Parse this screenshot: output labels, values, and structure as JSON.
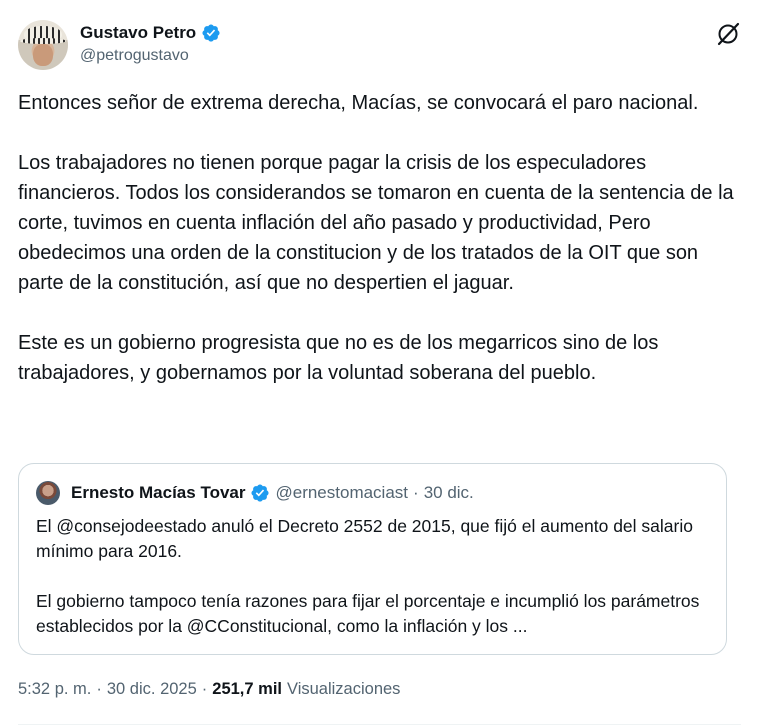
{
  "author": {
    "display_name": "Gustavo Petro",
    "handle": "@petrogustavo",
    "verified_icon": "verified-badge-icon",
    "avatar_icon": "avatar"
  },
  "actions": {
    "grok_icon": "grok-icon"
  },
  "tweet": {
    "paragraphs": [
      "Entonces señor de extrema derecha, Macías, se convocará el paro nacional.",
      "Los trabajadores no tienen porque pagar la crisis de los especuladores financieros. Todos los considerandos se tomaron en cuenta de la sentencia de la corte, tuvimos en cuenta inflación del año pasado y productividad, Pero obedecimos una orden de la constitucion y de los tratados de la OIT que son parte de la constitución, así que no despertien el jaguar.",
      "Este es un gobierno progresista que no es de los megarricos sino de los trabajadores, y gobernamos por la voluntad soberana del pueblo."
    ]
  },
  "quoted_tweet": {
    "display_name": "Ernesto Macías Tovar",
    "handle": "@ernestomaciast",
    "separator": "·",
    "date": "30 dic.",
    "paragraphs": [
      "El @consejodeestado anuló el Decreto 2552 de 2015, que fijó el aumento del salario mínimo para 2016.",
      "El gobierno tampoco tenía razones para fijar el porcentaje e incumplió los parámetros establecidos por la @CConstitucional, como la inflación y los ..."
    ]
  },
  "meta": {
    "time": "5:32 p. m.",
    "separator": "·",
    "date": "30 dic. 2025",
    "views_count": "251,7 mil",
    "views_label": "Visualizaciones"
  },
  "colors": {
    "text_primary": "#0f1419",
    "text_secondary": "#536471",
    "verified_blue": "#1d9bf0",
    "border": "#cfd9de"
  }
}
